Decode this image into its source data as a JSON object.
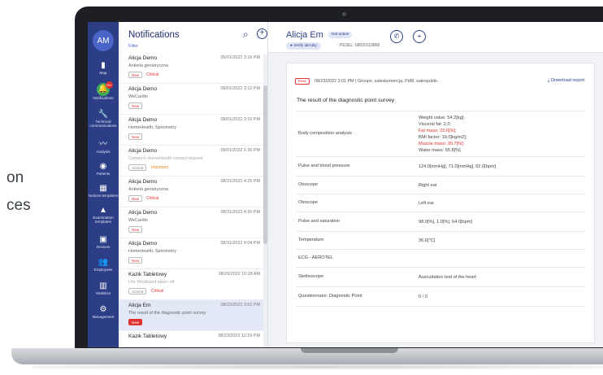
{
  "side_text": [
    "on",
    "ces"
  ],
  "nav": {
    "avatar": "AM",
    "items": [
      {
        "icon": "map-icon",
        "glyph": "▮",
        "label": "Map"
      },
      {
        "icon": "bell-icon",
        "glyph": "🔔",
        "label": "Notifications",
        "badge": "99+",
        "active": true
      },
      {
        "icon": "wrench-icon",
        "glyph": "🔧",
        "label": "Technical communications"
      },
      {
        "icon": "trend-icon",
        "glyph": "〰",
        "label": "Analysis"
      },
      {
        "icon": "patients-icon",
        "glyph": "◉",
        "label": "Patients"
      },
      {
        "icon": "grid-icon",
        "glyph": "▦",
        "label": "Notices templates"
      },
      {
        "icon": "shapes-icon",
        "glyph": "▲",
        "label": "Examination templates"
      },
      {
        "icon": "devices-icon",
        "glyph": "▣",
        "label": "Devices"
      },
      {
        "icon": "employees-icon",
        "glyph": "👥",
        "label": "Employees"
      },
      {
        "icon": "stats-icon",
        "glyph": "▥",
        "label": "Statistics"
      },
      {
        "icon": "gear-icon",
        "glyph": "⚙",
        "label": "Management"
      }
    ]
  },
  "notifications": {
    "title": "Notifications",
    "filter": "Filter",
    "items": [
      {
        "name": "Alicja Demo",
        "date": "05/01/2022 3:16 PM",
        "desc": "Ankieta geriatryczna",
        "tag": "New",
        "priority": "Critical"
      },
      {
        "name": "Alicja Demo",
        "date": "09/01/2022 3:12 PM",
        "desc": "WeCardio",
        "tag": "New",
        "priority": ""
      },
      {
        "name": "Alicja Demo",
        "date": "09/01/2022 3:10 PM",
        "desc": "HomeHealth: Spirometry",
        "tag": "New",
        "priority": ""
      },
      {
        "name": "Alicja Demo",
        "date": "09/01/2022 1:36 PM",
        "desc": "Comarch HomeHealth contact request",
        "tag": "Closed",
        "priority": "Important",
        "muted": true
      },
      {
        "name": "Alicja Demo",
        "date": "08/31/2022 4:25 PM",
        "desc": "Ankieta geriatryczna",
        "tag": "New",
        "priority": "Critical"
      },
      {
        "name": "Alicja Demo",
        "date": "08/31/2022 4:20 PM",
        "desc": "WeCardio",
        "tag": "New",
        "priority": ""
      },
      {
        "name": "Alicja Demo",
        "date": "08/31/2022 4:04 PM",
        "desc": "HomeHealth: Spirometry",
        "tag": "New",
        "priority": ""
      },
      {
        "name": "Kazik Tabletowy",
        "date": "08/29/2022 10:28 AM",
        "desc": "Life Wristband taken off",
        "tag": "Closed",
        "priority": "Critical",
        "muted": true
      },
      {
        "name": "Alicja Em",
        "date": "08/23/2022 3:01 PM",
        "desc": "The result of the diagnostic point survey",
        "tag": "New",
        "priority": "",
        "selected": true
      },
      {
        "name": "Kazik Tabletowy",
        "date": "08/23/2022 12:29 PM",
        "desc": "",
        "tag": "",
        "priority": ""
      }
    ]
  },
  "detail": {
    "name": "Alicja Em",
    "status": "Not active",
    "verify": "Verify identity",
    "pesel": "· PESEL: 68020119868",
    "card": {
      "tag": "New",
      "meta": "08/23/2022 3:01 PM  |  Groups: saleskomercja, PdM, salespublic",
      "download": "Download report",
      "title": "The result of the diagnostic point survey",
      "rows": [
        {
          "label": "Body composition analysis",
          "values": [
            {
              "text": "Weight value:  54.2[kg];",
              "red": false
            },
            {
              "text": "Visceral fat:  2.0;",
              "red": false
            },
            {
              "text": "Fat mass:  23.6[%];",
              "red": true
            },
            {
              "text": "BMI factor:  19.0[kg/m2];",
              "red": false
            },
            {
              "text": "Muscle mass:  30.7[%];",
              "red": true
            },
            {
              "text": "Water mass:  55.8[%]",
              "red": false
            }
          ]
        },
        {
          "label": "Pulse and blood pressure",
          "values": [
            {
              "text": "124.0[mmHg], 71.0[mmHg], 62.0[bpm]",
              "red": false
            }
          ]
        },
        {
          "label": "Otoscope",
          "values": [
            {
              "text": "Right ear",
              "red": false
            }
          ]
        },
        {
          "label": "Otoscope",
          "values": [
            {
              "text": "Left ear",
              "red": false
            }
          ]
        },
        {
          "label": "Pulse and saturation",
          "values": [
            {
              "text": "98.0[%], 1.0[%], 64.0[bpm]",
              "red": false
            }
          ]
        },
        {
          "label": "Temperature",
          "values": [
            {
              "text": "36.6[°C]",
              "red": false
            }
          ]
        },
        {
          "label": "ECG - AEROTEL",
          "values": []
        },
        {
          "label": "Stethoscope",
          "values": [
            {
              "text": "Auscultation test of the heart",
              "red": false
            }
          ]
        },
        {
          "label": "Questionnaire: Diagnostic Point",
          "values": [
            {
              "text": "0 / 0",
              "red": false
            }
          ]
        }
      ]
    }
  }
}
